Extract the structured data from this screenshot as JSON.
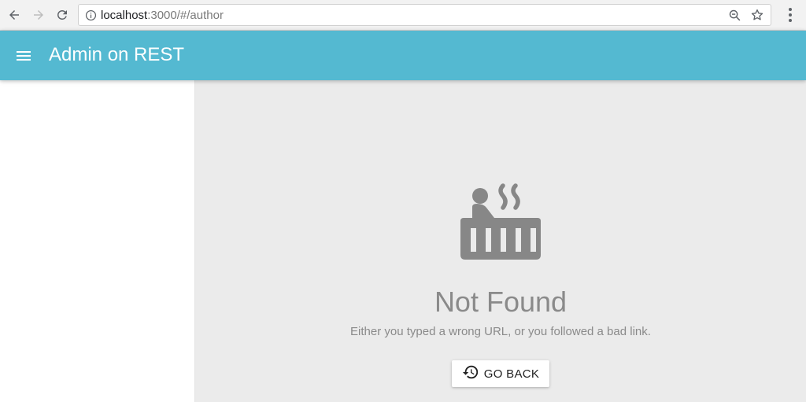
{
  "browser": {
    "url_host": "localhost",
    "url_rest": ":3000/#/author",
    "icons": [
      "back-arrow-icon",
      "forward-arrow-icon",
      "reload-icon",
      "info-icon",
      "zoom-icon",
      "star-icon",
      "menu-dots-icon"
    ]
  },
  "appbar": {
    "title": "Admin on REST",
    "color": "#54b9d1",
    "menu_icon": "hamburger-icon"
  },
  "not_found": {
    "icon": "hot-tub-icon",
    "title": "Not Found",
    "message": "Either you typed a wrong URL, or you followed a bad link.",
    "button_label": "GO BACK",
    "button_icon": "history-icon"
  }
}
